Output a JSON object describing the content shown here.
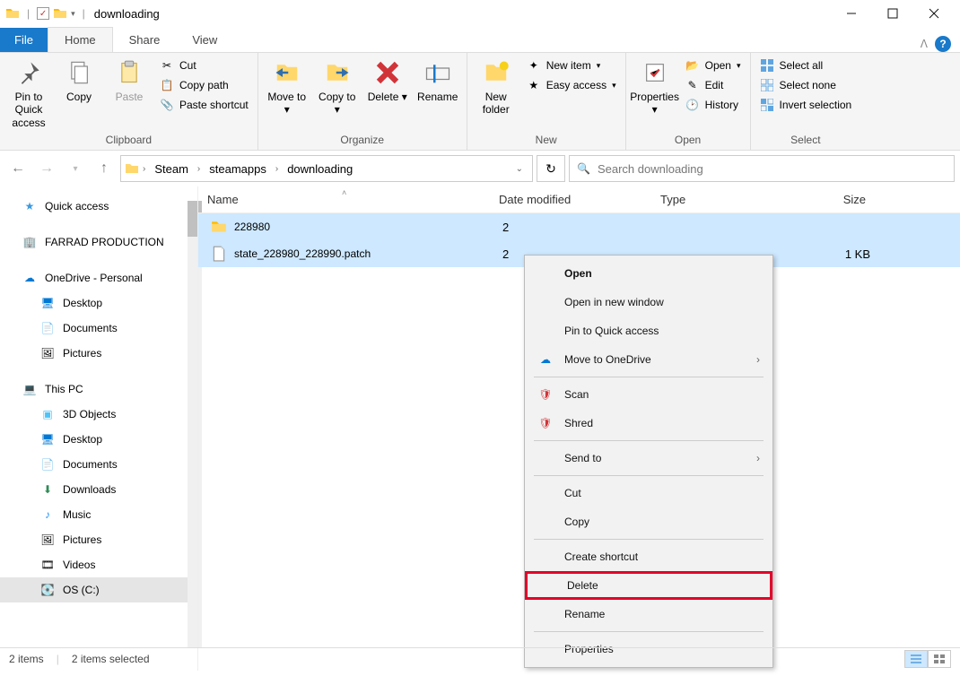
{
  "title": "downloading",
  "tabs": {
    "file": "File",
    "home": "Home",
    "share": "Share",
    "view": "View"
  },
  "ribbon": {
    "clipboard": {
      "label": "Clipboard",
      "pin_to_quick_access": "Pin to Quick access",
      "copy": "Copy",
      "paste": "Paste",
      "cut": "Cut",
      "copy_path": "Copy path",
      "paste_shortcut": "Paste shortcut"
    },
    "organize": {
      "label": "Organize",
      "move_to": "Move to",
      "copy_to": "Copy to",
      "delete": "Delete",
      "rename": "Rename"
    },
    "new": {
      "label": "New",
      "new_folder": "New folder",
      "new_item": "New item",
      "easy_access": "Easy access"
    },
    "open": {
      "label": "Open",
      "properties": "Properties",
      "open": "Open",
      "edit": "Edit",
      "history": "History"
    },
    "select": {
      "label": "Select",
      "select_all": "Select all",
      "select_none": "Select none",
      "invert_selection": "Invert selection"
    }
  },
  "breadcrumbs": [
    "Steam",
    "steamapps",
    "downloading"
  ],
  "search_placeholder": "Search downloading",
  "sidebar": {
    "quick_access": "Quick access",
    "custom1": "FARRAD PRODUCTION",
    "onedrive": "OneDrive - Personal",
    "od_desktop": "Desktop",
    "od_documents": "Documents",
    "od_pictures": "Pictures",
    "this_pc": "This PC",
    "pc_3d": "3D Objects",
    "pc_desktop": "Desktop",
    "pc_documents": "Documents",
    "pc_downloads": "Downloads",
    "pc_music": "Music",
    "pc_pictures": "Pictures",
    "pc_videos": "Videos",
    "pc_os": "OS (C:)"
  },
  "columns": {
    "name": "Name",
    "date": "Date modified",
    "type": "Type",
    "size": "Size"
  },
  "rows": [
    {
      "name": "228980",
      "date": "2",
      "type": "",
      "size": "",
      "icon": "folder"
    },
    {
      "name": "state_228980_228990.patch",
      "date": "2",
      "type": "",
      "size": "1 KB",
      "icon": "file"
    }
  ],
  "context_menu": {
    "open": "Open",
    "open_new_window": "Open in new window",
    "pin_quick_access": "Pin to Quick access",
    "move_onedrive": "Move to OneDrive",
    "scan": "Scan",
    "shred": "Shred",
    "send_to": "Send to",
    "cut": "Cut",
    "copy": "Copy",
    "create_shortcut": "Create shortcut",
    "delete": "Delete",
    "rename": "Rename",
    "properties": "Properties"
  },
  "status": {
    "count": "2 items",
    "selected": "2 items selected"
  }
}
